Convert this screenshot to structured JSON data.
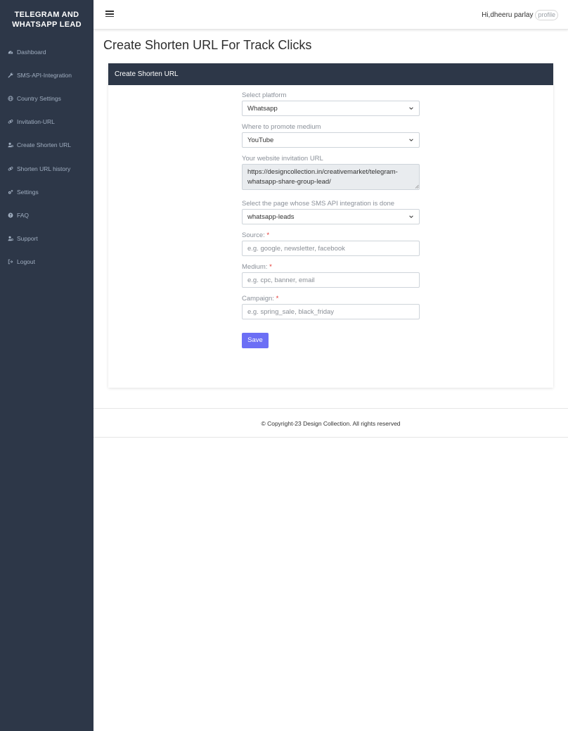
{
  "sidebar": {
    "brand_line1": "TELEGRAM AND",
    "brand_line2": "WHATSAPP LEAD",
    "items": [
      {
        "label": "Dashboard",
        "icon": "dashboard-icon"
      },
      {
        "label": "SMS-API-Integration",
        "icon": "wrench-icon"
      },
      {
        "label": "Country Settings",
        "icon": "globe-icon"
      },
      {
        "label": "Invitation-URL",
        "icon": "link-icon"
      },
      {
        "label": "Create Shorten URL",
        "icon": "user-cog-icon"
      },
      {
        "label": "Shorten URL history",
        "icon": "link-icon"
      },
      {
        "label": "Settings",
        "icon": "gears-icon"
      },
      {
        "label": "FAQ",
        "icon": "question-circle-icon"
      },
      {
        "label": "Support",
        "icon": "user-cog-icon"
      },
      {
        "label": "Logout",
        "icon": "sign-out-icon"
      }
    ]
  },
  "topbar": {
    "greeting": "Hi,dheeru parlay",
    "avatar_alt": "profile"
  },
  "page": {
    "title": "Create Shorten URL For Track Clicks"
  },
  "card": {
    "header": "Create Shorten URL"
  },
  "form": {
    "platform_label": "Select platform",
    "platform_value": "Whatsapp",
    "medium_select_label": "Where to promote medium",
    "medium_select_value": "YouTube",
    "url_label": "Your website invitation URL",
    "url_value": "https://designcollection.in/creativemarket/telegram-whatsapp-share-group-lead/",
    "page_label": "Select the page whose SMS API integration is done",
    "page_value": "whatsapp-leads",
    "source_label": "Source:",
    "source_placeholder": "e.g. google, newsletter, facebook",
    "medium_label": "Medium:",
    "medium_placeholder": "e.g. cpc, banner, email",
    "campaign_label": "Campaign:",
    "campaign_placeholder": "e.g. spring_sale, black_friday",
    "required_mark": "*",
    "save_label": "Save"
  },
  "footer": {
    "text": "© Copyright-23 Design Collection. All rights reserved"
  },
  "colors": {
    "sidebar_bg": "#2d3748",
    "accent_button": "#6c6ff5",
    "required": "#e3342f"
  }
}
